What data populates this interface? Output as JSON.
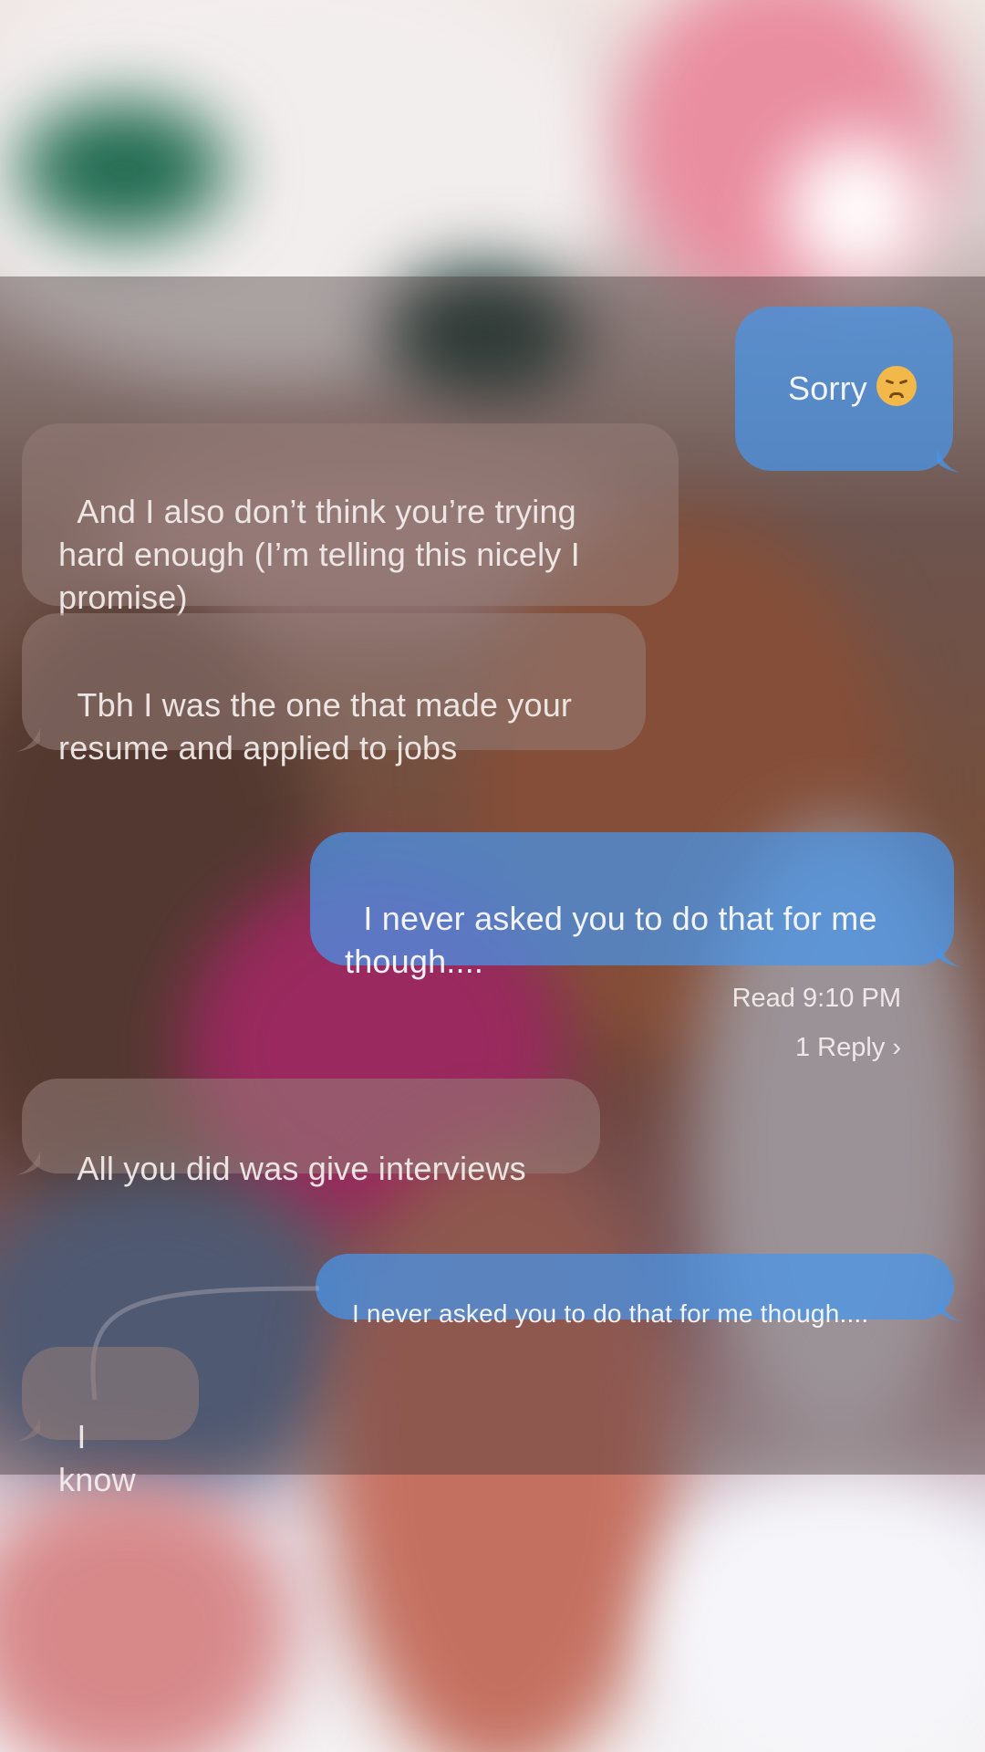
{
  "messages": [
    {
      "id": "m1",
      "direction": "out",
      "text": "Sorry",
      "emoji": "disappointed-face-icon"
    },
    {
      "id": "m2",
      "direction": "in",
      "text": "And I also don’t think you’re trying\nhard enough (I’m telling this nicely I\npromise)"
    },
    {
      "id": "m3",
      "direction": "in",
      "text": "Tbh I was the one that made your\nresume and applied to jobs"
    },
    {
      "id": "m4",
      "direction": "out",
      "text": "I never asked you to do that for me\nthough...."
    },
    {
      "id": "m5",
      "direction": "in",
      "text": "All you did was give interviews"
    },
    {
      "id": "m6",
      "direction": "out",
      "text": "I never asked you to do that for me though...."
    },
    {
      "id": "m7",
      "direction": "in",
      "text": "I know"
    }
  ],
  "receipt": {
    "status": "Read 9:10 PM"
  },
  "thread": {
    "reply_count_label": "1 Reply",
    "chevron": "›"
  },
  "colors": {
    "outgoing": "#4696eb",
    "incoming": "#967d78"
  }
}
